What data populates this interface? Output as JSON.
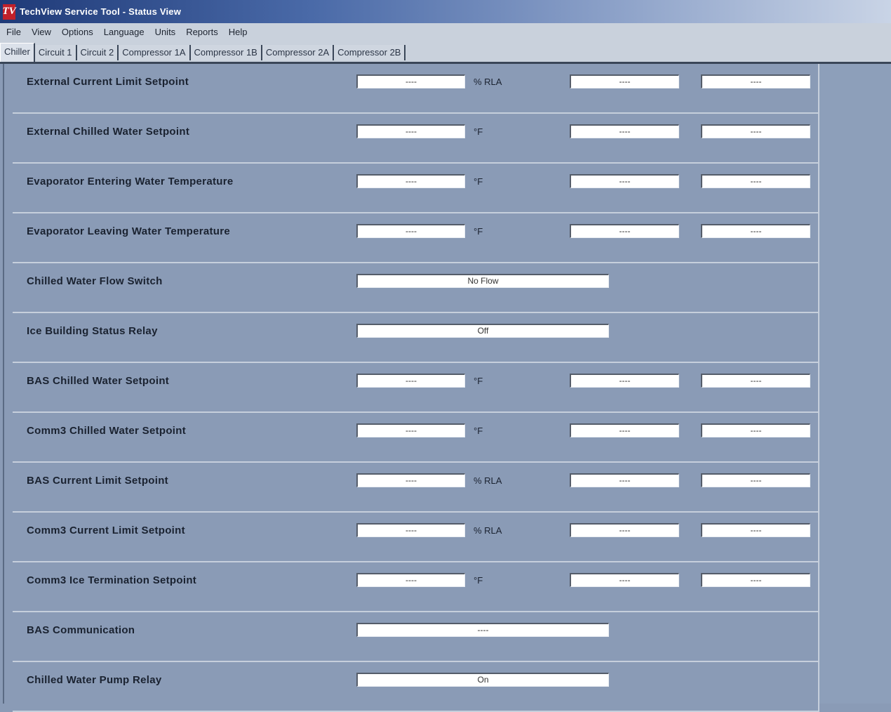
{
  "window": {
    "title": "TechView Service Tool - Status View",
    "logo_text": "TV"
  },
  "menu": [
    "File",
    "View",
    "Options",
    "Language",
    "Units",
    "Reports",
    "Help"
  ],
  "tabs": [
    "Chiller",
    "Circuit 1",
    "Circuit 2",
    "Compressor 1A",
    "Compressor 1B",
    "Compressor 2A",
    "Compressor 2B"
  ],
  "rows": [
    {
      "label": "External Current Limit Setpoint",
      "value": "----",
      "unit": "% RLA",
      "v2": "----",
      "v3": "----"
    },
    {
      "label": "External Chilled Water Setpoint",
      "value": "----",
      "unit": "°F",
      "v2": "----",
      "v3": "----"
    },
    {
      "label": "Evaporator Entering Water Temperature",
      "value": "----",
      "unit": "°F",
      "v2": "----",
      "v3": "----"
    },
    {
      "label": "Evaporator Leaving Water Temperature",
      "value": "----",
      "unit": "°F",
      "v2": "----",
      "v3": "----"
    },
    {
      "label": "Chilled Water Flow Switch",
      "value": "No Flow"
    },
    {
      "label": "Ice Building Status Relay",
      "value": "Off"
    },
    {
      "label": "BAS Chilled Water Setpoint",
      "value": "----",
      "unit": "°F",
      "v2": "----",
      "v3": "----"
    },
    {
      "label": "Comm3 Chilled Water Setpoint",
      "value": "----",
      "unit": "°F",
      "v2": "----",
      "v3": "----"
    },
    {
      "label": "BAS Current Limit Setpoint",
      "value": "----",
      "unit": "% RLA",
      "v2": "----",
      "v3": "----"
    },
    {
      "label": "Comm3 Current Limit Setpoint",
      "value": "----",
      "unit": "% RLA",
      "v2": "----",
      "v3": "----"
    },
    {
      "label": "Comm3 Ice Termination Setpoint",
      "value": "----",
      "unit": "°F",
      "v2": "----",
      "v3": "----"
    },
    {
      "label": "BAS Communication",
      "value": "----"
    },
    {
      "label": "Chilled Water Pump Relay",
      "value": "On"
    }
  ]
}
